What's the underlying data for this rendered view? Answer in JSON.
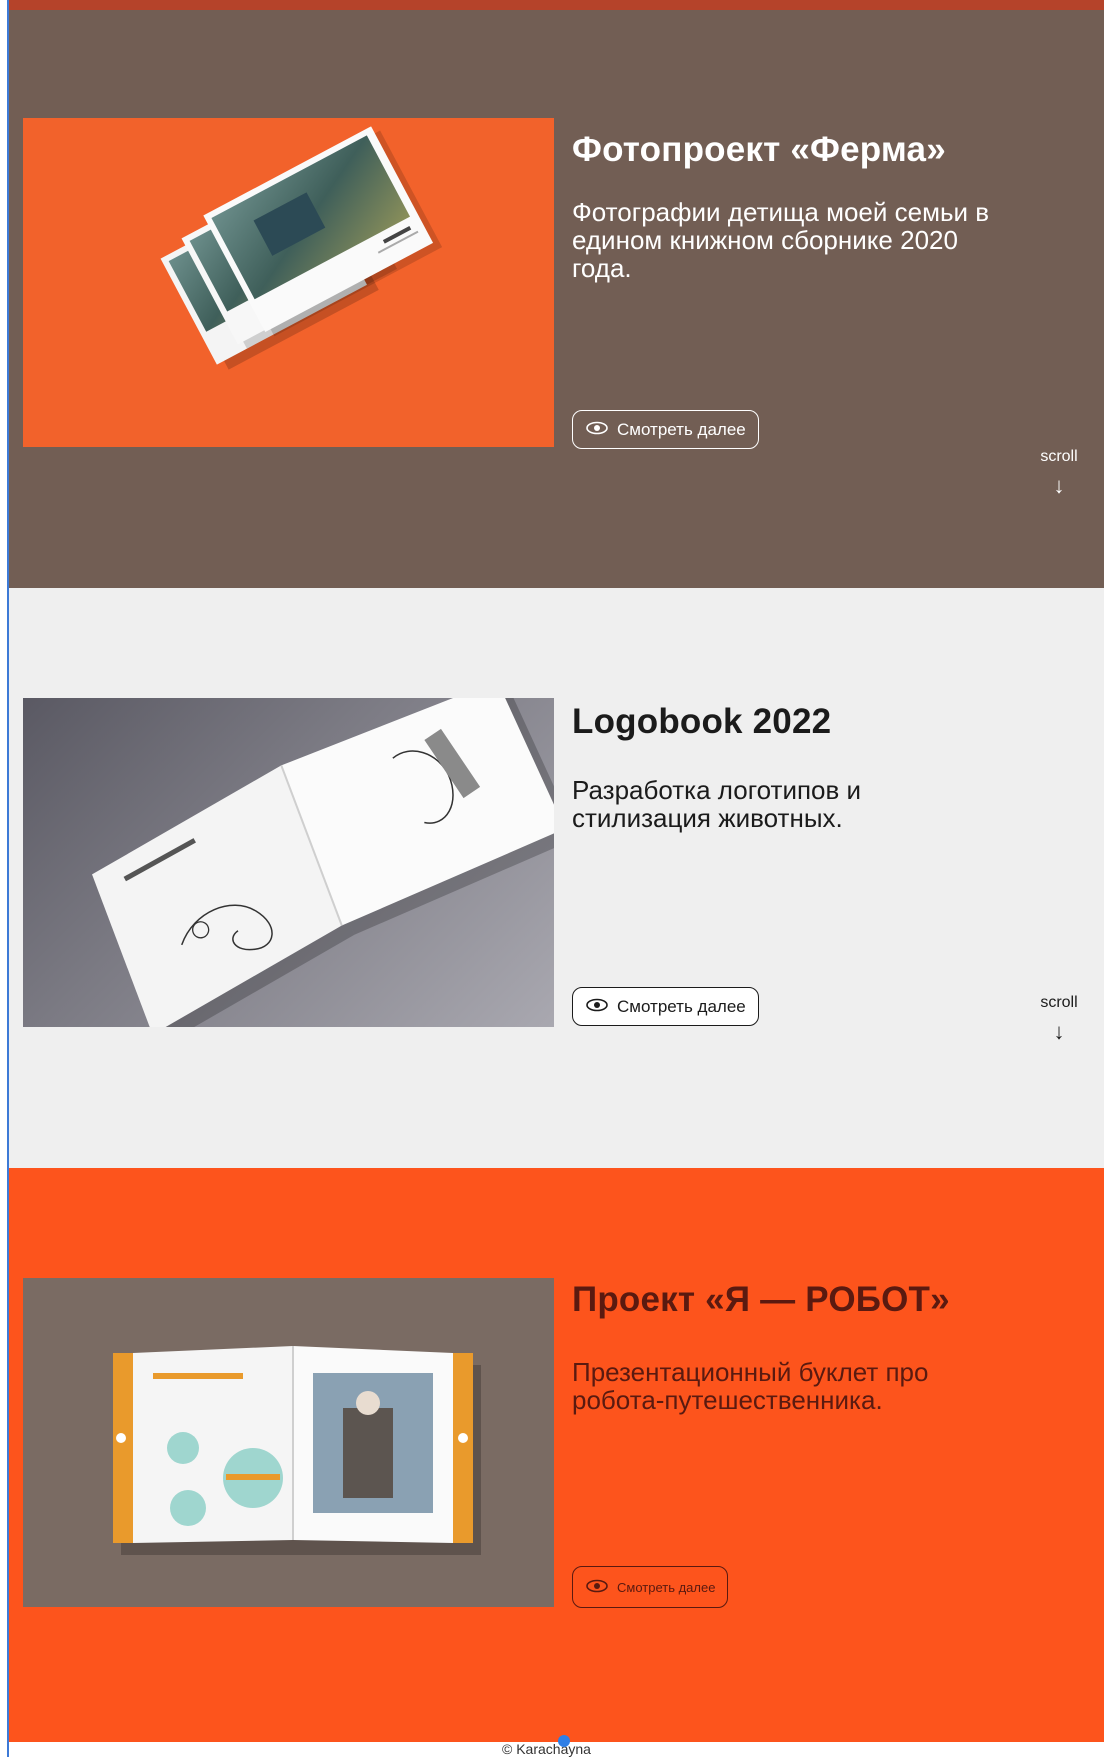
{
  "projects": [
    {
      "title": "Фотопроект «Ферма»",
      "description": "Фотографии детища моей семьи в едином книжном сборнике 2020 года.",
      "button_label": "Смотреть далее",
      "scroll_label": "scroll",
      "colors": {
        "background": "#725e54",
        "text": "#ffffff",
        "thumb_bg": "#f2622b"
      }
    },
    {
      "title": "Logobook 2022",
      "description": "Разработка логотипов и стилизация животных.",
      "button_label": "Смотреть далее",
      "scroll_label": "scroll",
      "colors": {
        "background": "#efefef",
        "text": "#1b1b1b",
        "thumb_bg": "#7b7a83"
      }
    },
    {
      "title": "Проект «Я — РОБОТ»",
      "description": "Презентационный буклет про робота-путешественника.",
      "button_label": "Смотреть далее",
      "colors": {
        "background": "#fd541c",
        "text": "#5a1a10",
        "thumb_bg": "#7a6b63"
      }
    }
  ],
  "icons": {
    "button_icon": "eye-icon",
    "scroll_icon": "arrow-down-icon"
  },
  "footer": {
    "copyright": "© Karachayna"
  }
}
